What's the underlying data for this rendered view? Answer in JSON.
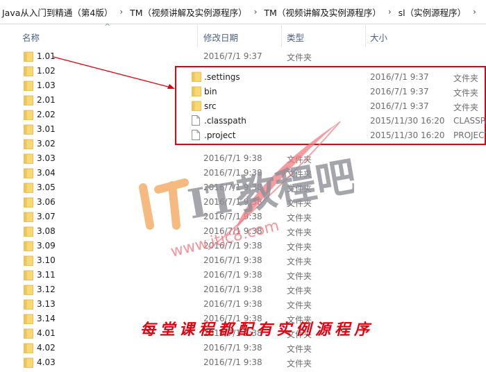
{
  "breadcrumb": [
    {
      "label": "Java从入门到精通（第4版）"
    },
    {
      "label": "TM（视频讲解及实例源程序）"
    },
    {
      "label": "TM（视频讲解及实例源程序）"
    },
    {
      "label": "sl（实例源程序）"
    }
  ],
  "breadcrumb_separator": "›",
  "columns": {
    "name": "名称",
    "modified": "修改日期",
    "type": "类型",
    "size": "大小",
    "sort_caret": "^"
  },
  "rows": [
    {
      "name": "1.01",
      "date": "2016/7/1 9:37",
      "type": "文件夹"
    },
    {
      "name": "1.02",
      "date": "",
      "type": ""
    },
    {
      "name": "1.03",
      "date": "",
      "type": ""
    },
    {
      "name": "2.01",
      "date": "",
      "type": ""
    },
    {
      "name": "2.02",
      "date": "",
      "type": ""
    },
    {
      "name": "3.01",
      "date": "",
      "type": ""
    },
    {
      "name": "3.02",
      "date": "",
      "type": ""
    },
    {
      "name": "3.03",
      "date": "2016/7/1 9:38",
      "type": "文件夹"
    },
    {
      "name": "3.04",
      "date": "2016/7/1 9:38",
      "type": "文件夹"
    },
    {
      "name": "3.05",
      "date": "2016/7/1 9:38",
      "type": "文件夹"
    },
    {
      "name": "3.06",
      "date": "2016/7/1 9:38",
      "type": "文件夹"
    },
    {
      "name": "3.07",
      "date": "2016/7/1 9:38",
      "type": "文件夹"
    },
    {
      "name": "3.08",
      "date": "2016/7/1 9:38",
      "type": "文件夹"
    },
    {
      "name": "3.09",
      "date": "2016/7/1 9:38",
      "type": "文件夹"
    },
    {
      "name": "3.10",
      "date": "2016/7/1 9:38",
      "type": "文件夹"
    },
    {
      "name": "3.11",
      "date": "2016/7/1 9:38",
      "type": "文件夹"
    },
    {
      "name": "3.12",
      "date": "2016/7/1 9:38",
      "type": "文件夹"
    },
    {
      "name": "3.13",
      "date": "2016/7/1 9:38",
      "type": "文件夹"
    },
    {
      "name": "3.14",
      "date": "2016/7/1 9:38",
      "type": "文件夹"
    },
    {
      "name": "4.01",
      "date": "2016/7/1 9:38",
      "type": "文件夹"
    },
    {
      "name": "4.02",
      "date": "2016/7/1 9:38",
      "type": "文件夹"
    },
    {
      "name": "4.03",
      "date": "2016/7/1 9:38",
      "type": "文件夹"
    }
  ],
  "popup": {
    "rows": [
      {
        "name": ".settings",
        "date": "2016/7/1 9:37",
        "type": "文件夹",
        "icon": "folder-icon"
      },
      {
        "name": "bin",
        "date": "2016/7/1 9:37",
        "type": "文件夹",
        "icon": "folder-icon"
      },
      {
        "name": "src",
        "date": "2016/7/1 9:37",
        "type": "文件夹",
        "icon": "folder-icon"
      },
      {
        "name": ".classpath",
        "date": "2015/11/30 16:20",
        "type": "CLASSPA",
        "icon": "file-icon"
      },
      {
        "name": ".project",
        "date": "2015/11/30 16:20",
        "type": "PROJECT",
        "icon": "file-icon"
      }
    ]
  },
  "watermark": {
    "brand": "IT教程吧",
    "url": "www.itjc8.com"
  },
  "caption": "每堂课程都配有实例源程序",
  "colors": {
    "folder_yellow": "#f8d775",
    "folder_dark": "#e0b84a",
    "highlight_red": "#e3000f",
    "header_text": "#4d6082"
  }
}
